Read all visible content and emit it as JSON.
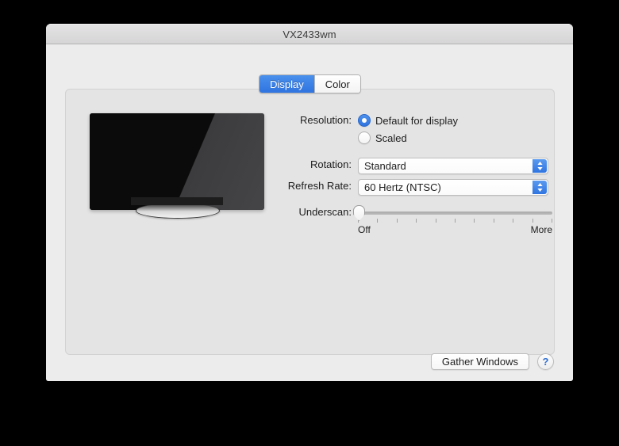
{
  "window": {
    "title": "VX2433wm"
  },
  "tabs": [
    {
      "label": "Display",
      "selected": true
    },
    {
      "label": "Color",
      "selected": false
    }
  ],
  "preview": {
    "icon_name": "display-monitor-illustration"
  },
  "display_settings": {
    "resolution": {
      "label": "Resolution:",
      "options": [
        {
          "label": "Default for display",
          "selected": true
        },
        {
          "label": "Scaled",
          "selected": false
        }
      ]
    },
    "rotation": {
      "label": "Rotation:",
      "value": "Standard"
    },
    "refresh_rate": {
      "label": "Refresh Rate:",
      "value": "60 Hertz (NTSC)"
    },
    "underscan": {
      "label": "Underscan:",
      "min_label": "Off",
      "max_label": "More",
      "value_percent": 0,
      "tick_count": 11
    }
  },
  "footer": {
    "gather_windows_label": "Gather Windows",
    "help_label": "?"
  },
  "colors": {
    "accent_blue": "#2f74e0",
    "window_bg": "#ececec",
    "tab_panel_bg": "#e4e4e4",
    "text": "#1d1d1d",
    "desktop_bg": "#000000"
  }
}
